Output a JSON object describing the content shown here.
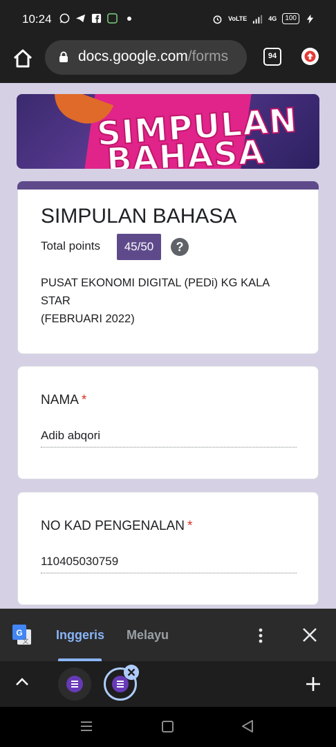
{
  "status_bar": {
    "time": "10:24",
    "battery": "100",
    "network": "4G"
  },
  "browser": {
    "url_main": "docs.google.com",
    "url_path": "/forms",
    "tab_count": "94"
  },
  "form": {
    "title": "SIMPULAN BAHASA",
    "points_label": "Total points",
    "points_value": "45/50",
    "description_lines": [
      "PUSAT EKONOMI DIGITAL (PEDi) KG KALA",
      "STAR",
      "(FEBRUARI 2022)"
    ],
    "banner_text_1": "SIMPULAN",
    "banner_text_2": "BAHASA",
    "accent_color": "#5e4a8b",
    "background_color": "#d5d0e4"
  },
  "questions": [
    {
      "label": "NAMA",
      "required_mark": "*",
      "answer": "Adib abqori"
    },
    {
      "label": "NO KAD PENGENALAN",
      "required_mark": "*",
      "answer": "110405030759"
    }
  ],
  "translate_bar": {
    "active_language": "Inggeris",
    "other_language": "Melayu"
  },
  "icons": {
    "home": "home-icon",
    "lock": "lock-icon",
    "update": "update-arrow-icon",
    "translate": "google-translate-icon",
    "more": "more-vert-icon",
    "close": "close-icon",
    "tab_strip_toggle": "chevron-up-icon",
    "new_tab": "plus-icon",
    "forms_tab": "google-forms-icon"
  }
}
